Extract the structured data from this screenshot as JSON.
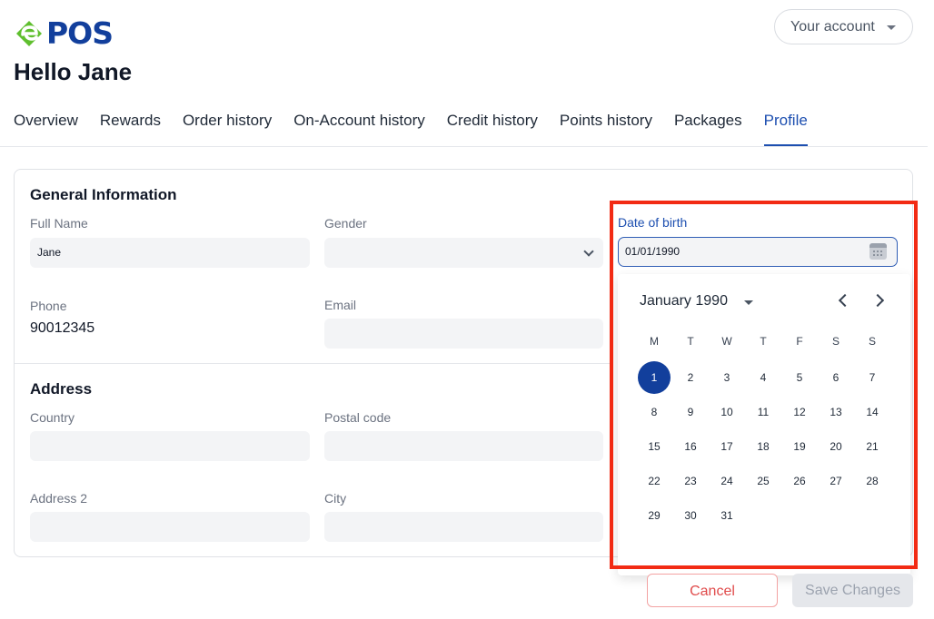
{
  "brand": {
    "logo_text": "POS",
    "logo_mark_letter": "e",
    "colors": {
      "green": "#5fbf2e",
      "blue": "#123f9c"
    }
  },
  "header": {
    "account_label": "Your account",
    "greeting": "Hello Jane"
  },
  "tabs": [
    {
      "label": "Overview",
      "active": false
    },
    {
      "label": "Rewards",
      "active": false
    },
    {
      "label": "Order history",
      "active": false
    },
    {
      "label": "On-Account history",
      "active": false
    },
    {
      "label": "Credit history",
      "active": false
    },
    {
      "label": "Points history",
      "active": false
    },
    {
      "label": "Packages",
      "active": false
    },
    {
      "label": "Profile",
      "active": true
    }
  ],
  "general": {
    "title": "General Information",
    "full_name_label": "Full Name",
    "full_name_value": "Jane",
    "gender_label": "Gender",
    "gender_value": "",
    "phone_label": "Phone",
    "phone_value": "90012345",
    "email_label": "Email",
    "email_value": "",
    "dob_label": "Date of birth",
    "dob_value": "01/01/1990"
  },
  "address": {
    "title": "Address",
    "country_label": "Country",
    "country_value": "",
    "postal_label": "Postal code",
    "postal_value": "",
    "address2_label": "Address 2",
    "address2_value": "",
    "city_label": "City",
    "city_value": ""
  },
  "calendar": {
    "month_year": "January 1990",
    "weekdays": [
      "M",
      "T",
      "W",
      "T",
      "F",
      "S",
      "S"
    ],
    "days_in_month": 31,
    "first_weekday_index": 0,
    "selected_day": 1
  },
  "footer": {
    "cancel_label": "Cancel",
    "save_label": "Save Changes"
  }
}
